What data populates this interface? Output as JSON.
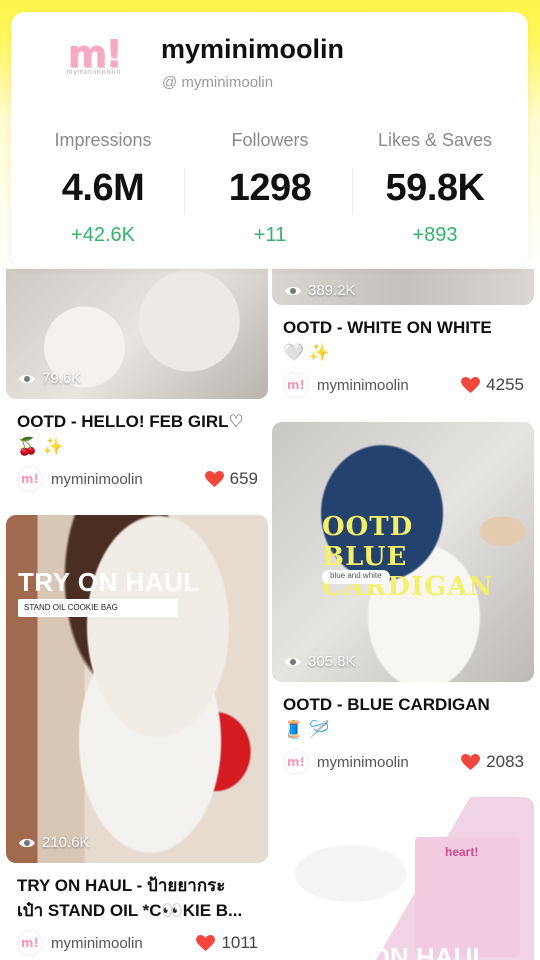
{
  "profile": {
    "logo_text": "m!",
    "logo_sub": "myminimoolin",
    "name": "myminimoolin",
    "handle": "@ myminimoolin"
  },
  "stats": [
    {
      "label": "Impressions",
      "value": "4.6M",
      "delta": "+42.6K"
    },
    {
      "label": "Followers",
      "value": "1298",
      "delta": "+11"
    },
    {
      "label": "Likes & Saves",
      "value": "59.8K",
      "delta": "+893"
    }
  ],
  "colors": {
    "accent_yellow": "#fff44a",
    "delta_green": "#34b36b",
    "heart_red": "#f2473f"
  },
  "posts": [
    {
      "id": "hello",
      "views": "79.6K",
      "title_line1": "OOTD - HELLO! FEB GIRL♡",
      "title_line2": "🍒 ✨",
      "author": "myminimoolin",
      "likes": "659"
    },
    {
      "id": "white",
      "views": "389.2K",
      "title_line1": "OOTD - WHITE ON WHITE",
      "title_line2": "🤍 ✨",
      "author": "myminimoolin",
      "likes": "4255"
    },
    {
      "id": "tryon",
      "views": "210.6K",
      "overlay_title": "TRY ON HAUL",
      "overlay_pill": "STAND OIL COOKIE BAG",
      "title_line1": "TRY ON HAUL - ป้ายยากระ",
      "title_line2": "เป๋า STAND OIL *C👀KIE B...",
      "author": "myminimoolin",
      "likes": "1011"
    },
    {
      "id": "cardigan",
      "views": "305.8K",
      "overlay_title_1": "OOTD",
      "overlay_title_2": "BLUE CARDIGAN",
      "overlay_pill": "blue and white",
      "title_line1": "OOTD - BLUE CARDIGAN",
      "title_line2": "🧵 🪡",
      "author": "myminimoolin",
      "likes": "2083"
    },
    {
      "id": "heart",
      "overlay_label": "heart!",
      "overlay_bottom": "TRY ON HAUL"
    }
  ]
}
